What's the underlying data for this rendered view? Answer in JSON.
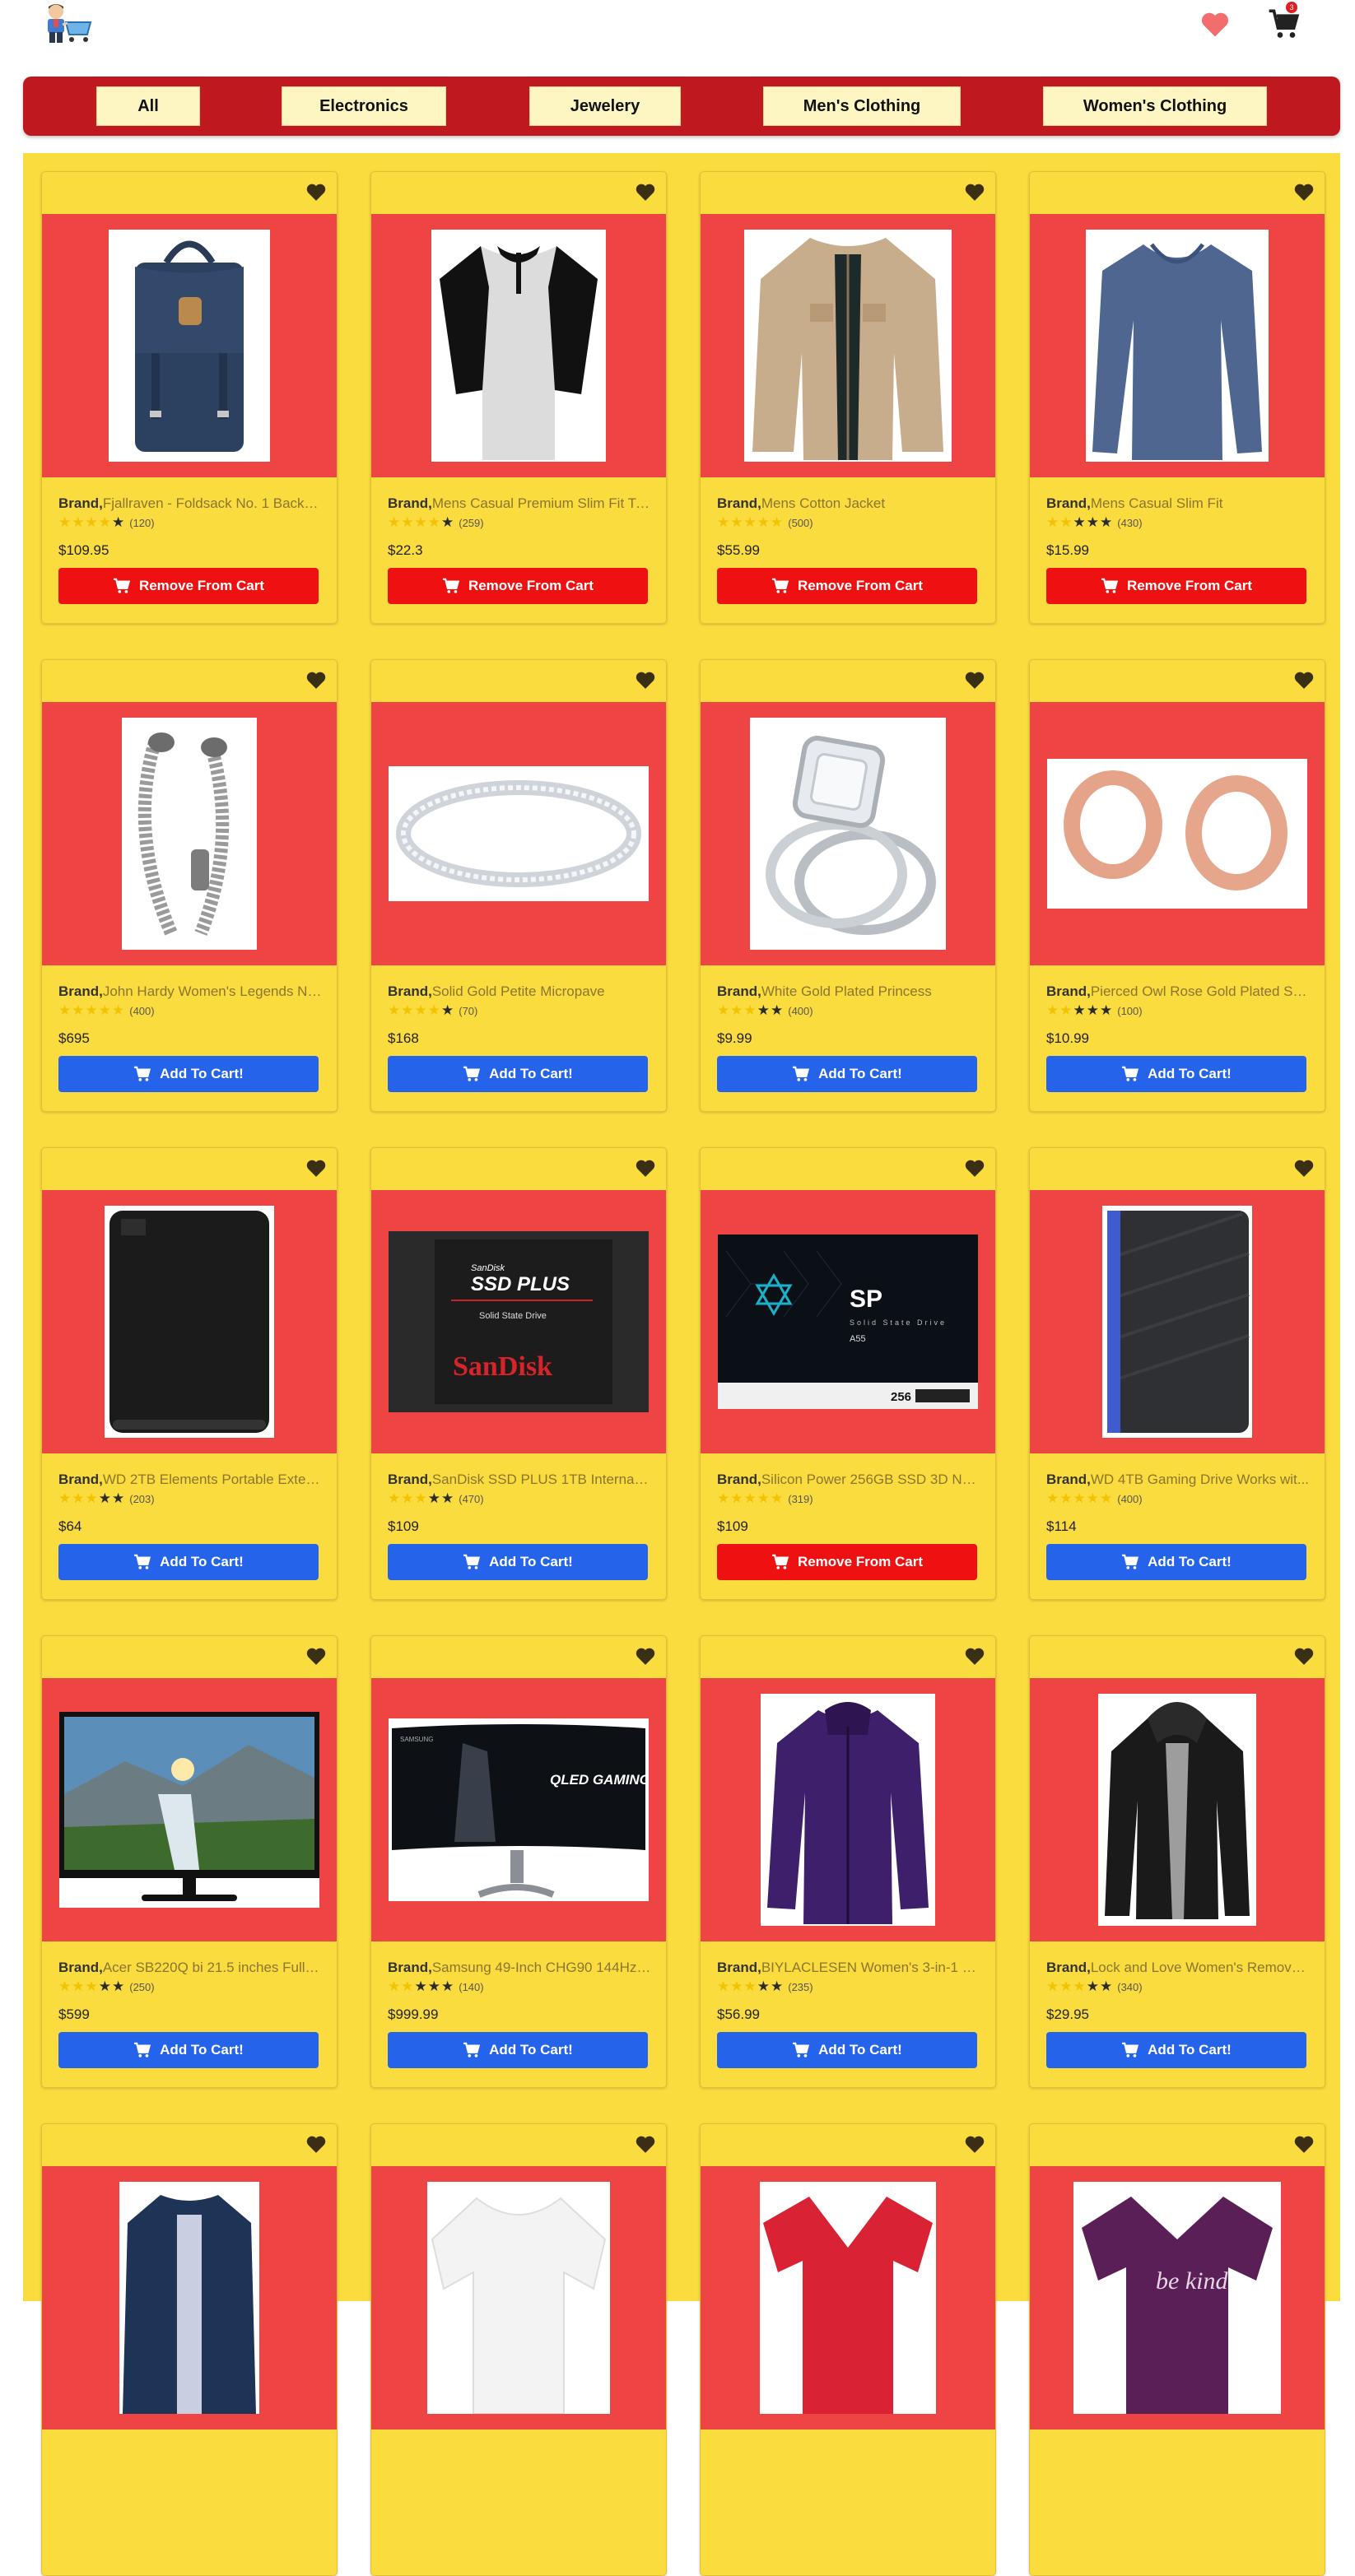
{
  "header": {
    "cart_count": "3"
  },
  "nav": {
    "items": [
      "All",
      "Electronics",
      "Jewelery",
      "Men's Clothing",
      "Women's Clothing"
    ]
  },
  "colors": {
    "nav_bg": "#c0181f",
    "page_bg": "#fbdc3f",
    "image_bg": "#ef4444",
    "add_button": "#2563eb",
    "remove_button": "#ef1111"
  },
  "products": [
    {
      "brand": "Brand,",
      "title": "Fjallraven - Foldsack No. 1 Backpa...",
      "rating": 1,
      "count": "(120)",
      "price": "$109.95",
      "button": "Remove From Cart",
      "in_cart": true,
      "image": "backpack"
    },
    {
      "brand": "Brand,",
      "title": "Mens Casual Premium Slim Fit T-S...",
      "rating": 1,
      "count": "(259)",
      "price": "$22.3",
      "button": "Remove From Cart",
      "in_cart": true,
      "image": "raglan-tshirt"
    },
    {
      "brand": "Brand,",
      "title": "Mens Cotton Jacket",
      "rating": 0,
      "count": "(500)",
      "price": "$55.99",
      "button": "Remove From Cart",
      "in_cart": true,
      "image": "cotton-jacket"
    },
    {
      "brand": "Brand,",
      "title": "Mens Casual Slim Fit",
      "rating": 3,
      "count": "(430)",
      "price": "$15.99",
      "button": "Remove From Cart",
      "in_cart": true,
      "image": "longsleeve-shirt"
    },
    {
      "brand": "Brand,",
      "title": "John Hardy Women's Legends Na...",
      "rating": 0,
      "count": "(400)",
      "price": "$695",
      "button": "Add To Cart!",
      "in_cart": false,
      "image": "dragon-bracelet"
    },
    {
      "brand": "Brand,",
      "title": "Solid Gold Petite Micropave",
      "rating": 1,
      "count": "(70)",
      "price": "$168",
      "button": "Add To Cart!",
      "in_cart": false,
      "image": "gold-ring"
    },
    {
      "brand": "Brand,",
      "title": "White Gold Plated Princess",
      "rating": 2,
      "count": "(400)",
      "price": "$9.99",
      "button": "Add To Cart!",
      "in_cart": false,
      "image": "princess-ring"
    },
    {
      "brand": "Brand,",
      "title": "Pierced Owl Rose Gold Plated Stai...",
      "rating": 3,
      "count": "(100)",
      "price": "$10.99",
      "button": "Add To Cart!",
      "in_cart": false,
      "image": "rose-gold-plugs"
    },
    {
      "brand": "Brand,",
      "title": "WD 2TB Elements Portable Extern...",
      "rating": 2,
      "count": "(203)",
      "price": "$64",
      "button": "Add To Cart!",
      "in_cart": false,
      "image": "external-drive"
    },
    {
      "brand": "Brand,",
      "title": "SanDisk SSD PLUS 1TB Internal SS...",
      "rating": 2,
      "count": "(470)",
      "price": "$109",
      "button": "Add To Cart!",
      "in_cart": false,
      "image": "sandisk-ssd",
      "label_top": "SanDisk",
      "label_main": "SSD PLUS",
      "label_sub": "Solid State Drive",
      "label_brand": "SanDisk"
    },
    {
      "brand": "Brand,",
      "title": "Silicon Power 256GB SSD 3D NAN...",
      "rating": 0,
      "count": "(319)",
      "price": "$109",
      "button": "Remove From Cart",
      "in_cart": true,
      "image": "silicon-power-ssd",
      "label_main": "SP",
      "label_sub": "Solid State Drive",
      "label_model": "A55",
      "label_size": "256"
    },
    {
      "brand": "Brand,",
      "title": "WD 4TB Gaming Drive Works wit...",
      "rating": 0,
      "count": "(400)",
      "price": "$114",
      "button": "Add To Cart!",
      "in_cart": false,
      "image": "gaming-drive"
    },
    {
      "brand": "Brand,",
      "title": "Acer SB220Q bi 21.5 inches Full H...",
      "rating": 2,
      "count": "(250)",
      "price": "$599",
      "button": "Add To Cart!",
      "in_cart": false,
      "image": "acer-monitor"
    },
    {
      "brand": "Brand,",
      "title": "Samsung 49-Inch CHG90 144Hz ...",
      "rating": 3,
      "count": "(140)",
      "price": "$999.99",
      "button": "Add To Cart!",
      "in_cart": false,
      "image": "samsung-monitor",
      "label_brand": "SAMSUNG",
      "label_main": "QLED GAMING MONITOR"
    },
    {
      "brand": "Brand,",
      "title": "BIYLACLESEN Women's 3-in-1 Sn...",
      "rating": 2,
      "count": "(235)",
      "price": "$56.99",
      "button": "Add To Cart!",
      "in_cart": false,
      "image": "purple-jacket"
    },
    {
      "brand": "Brand,",
      "title": "Lock and Love Women's Remova...",
      "rating": 2,
      "count": "(340)",
      "price": "$29.95",
      "button": "Add To Cart!",
      "in_cart": false,
      "image": "leather-jacket"
    },
    {
      "image": "blue-rain-jacket"
    },
    {
      "image": "white-top"
    },
    {
      "image": "red-vneck"
    },
    {
      "image": "purple-tee",
      "label_main": "be kind"
    }
  ]
}
